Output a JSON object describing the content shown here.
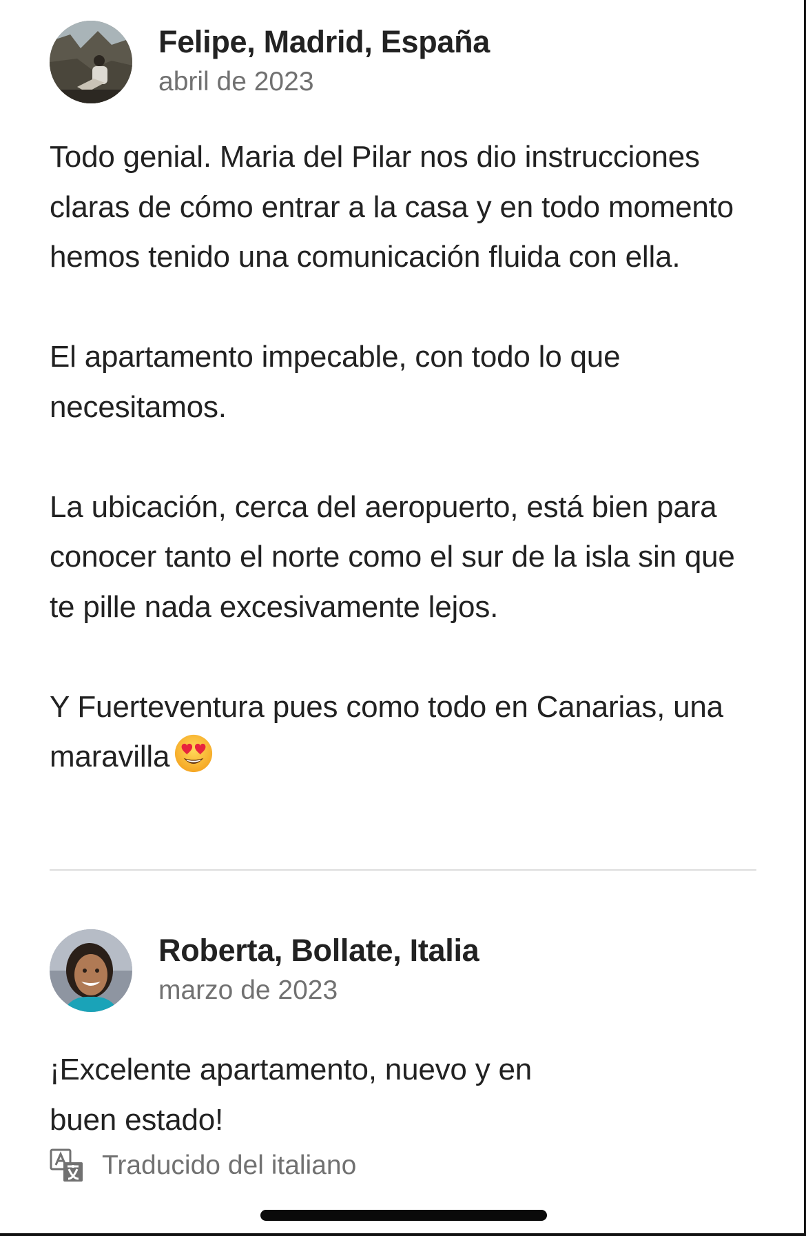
{
  "reviews": [
    {
      "author": "Felipe, Madrid, España",
      "date": "abril de 2023",
      "avatar_icon": "avatar-photo-person-sitting",
      "paragraphs": [
        "Todo genial. Maria del Pilar nos dio instrucciones claras de cómo entrar a la casa y en todo momento hemos tenido una comunicación fluida con ella.",
        "El apartamento impecable, con todo lo que necesitamos.",
        "La ubicación, cerca del aeropuerto, está bien para conocer tanto el norte como el sur de la isla sin que te pille nada excesivamente lejos.",
        "Y Fuerteventura pues como todo en Canarias, una maravilla"
      ],
      "trailing_emoji": "heart-eyes-emoji"
    },
    {
      "author": "Roberta, Bollate, Italia",
      "date": "marzo de 2023",
      "avatar_icon": "avatar-photo-smiling-woman",
      "paragraphs": [
        "¡Excelente apartamento, nuevo y en buen estado!"
      ],
      "translation_note": "Traducido del italiano",
      "translation_icon": "translate-icon"
    }
  ],
  "colors": {
    "text_primary": "#222222",
    "text_secondary": "#717171",
    "divider": "#dddddd",
    "background": "#ffffff"
  }
}
